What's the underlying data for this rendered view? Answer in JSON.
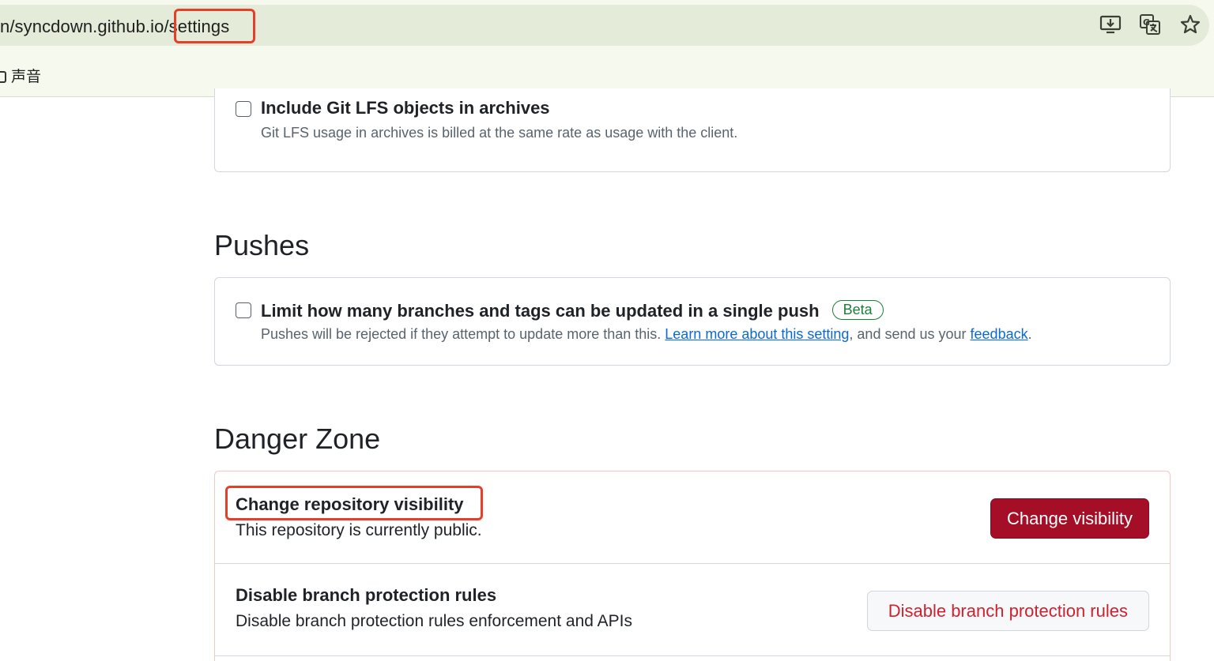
{
  "browser": {
    "url_host": "n/syncdown.github.io",
    "url_path": "/settings",
    "bookmark_label": "声音",
    "icons": [
      "install-app-icon",
      "translate-icon",
      "bookmark-star-icon"
    ]
  },
  "archives": {
    "lfs_option": {
      "title": "Include Git LFS objects in archives",
      "description": "Git LFS usage in archives is billed at the same rate as usage with the client.",
      "checked": false
    }
  },
  "pushes": {
    "heading": "Pushes",
    "limit_option": {
      "title": "Limit how many branches and tags can be updated in a single push",
      "badge": "Beta",
      "description_prefix": "Pushes will be rejected if they attempt to update more than this. ",
      "learn_more_link": "Learn more about this setting",
      "description_middle": ", and send us your ",
      "feedback_link": "feedback",
      "description_suffix": ".",
      "checked": false
    }
  },
  "danger_zone": {
    "heading": "Danger Zone",
    "visibility": {
      "title": "Change repository visibility",
      "description": "This repository is currently public.",
      "button": "Change visibility"
    },
    "branch_protection": {
      "title": "Disable branch protection rules",
      "description": "Disable branch protection rules enforcement and APIs",
      "button": "Disable branch protection rules"
    }
  },
  "colors": {
    "annotation_highlight": "#e53f2a",
    "danger_button": "#a40e26",
    "link": "#0969da",
    "beta_badge": "#1a7f37"
  }
}
